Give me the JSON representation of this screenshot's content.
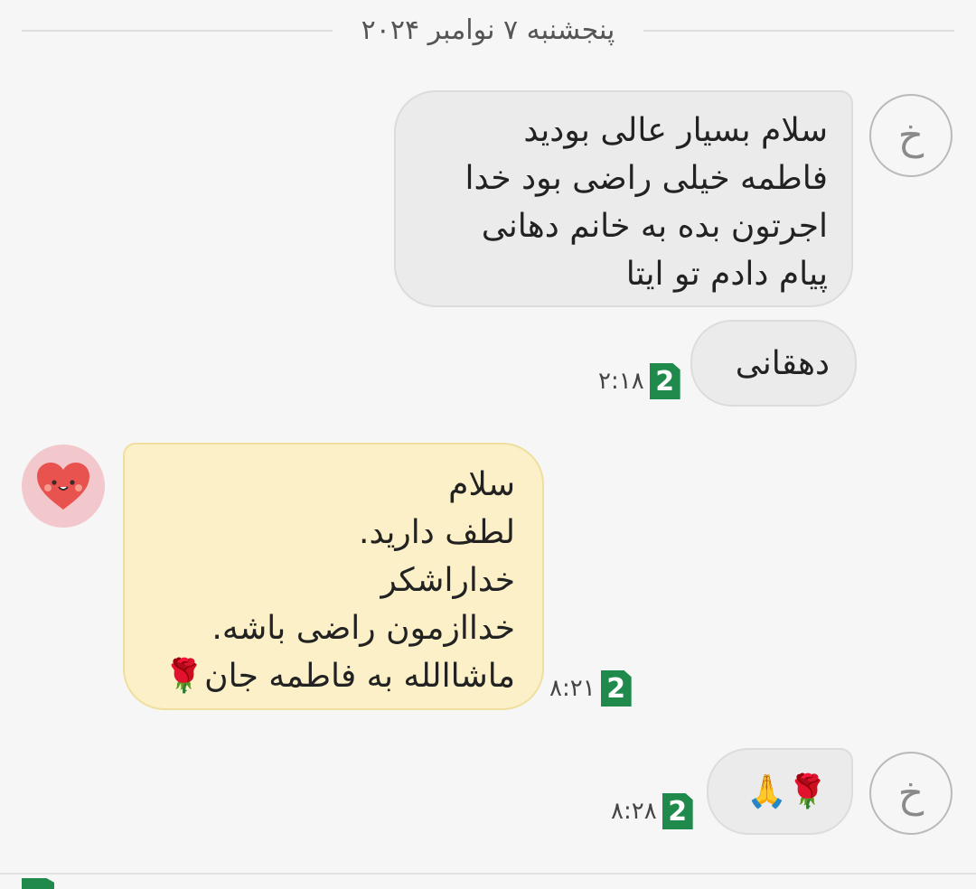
{
  "date_separator": "پنجشنبه ۷ نوامبر ۲۰۲۴",
  "contact_initial": "خ",
  "messages": [
    {
      "direction": "outgoing",
      "lines": [
        "سلام بسیار عالی بودید",
        "فاطمه خیلی راضی بود خدا",
        "اجرتون بده  به خانم دهانی",
        "پیام دادم تو ایتا"
      ]
    },
    {
      "direction": "outgoing",
      "lines": [
        "دهقانی"
      ],
      "sim": "2",
      "time": "۲:۱۸"
    },
    {
      "direction": "incoming",
      "avatar": "heart-face-icon",
      "lines": [
        "سلام",
        "لطف دارید.",
        "خداراشکر",
        "خداازمون راضی باشه.",
        "ماشاالله به فاطمه جان🌹"
      ],
      "sim": "2",
      "time": "۸:۲۱"
    },
    {
      "direction": "outgoing",
      "lines": [
        "🌹🙏"
      ],
      "sim": "2",
      "time": "۸:۲۸"
    }
  ],
  "colors": {
    "outgoing_bubble": "#ebebeb",
    "incoming_bubble": "#fcf0c8",
    "sim_badge": "#1f8a4c",
    "incoming_avatar_bg": "#f3c8cc"
  }
}
